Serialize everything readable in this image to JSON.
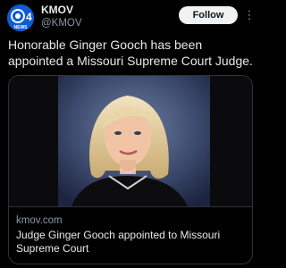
{
  "account": {
    "display_name": "KMOV",
    "handle": "@KMOV",
    "avatar": {
      "logo_text": "4",
      "logo_subtext": "NEWS",
      "brand_color": "#0f5bd3"
    }
  },
  "follow_label": "Follow",
  "more_icon": "more-dots-icon",
  "tweet_text": "Honorable Ginger Gooch has been appointed a Missouri Supreme Court Judge.",
  "card": {
    "image_description_icon": "portrait-photo",
    "domain": "kmov.com",
    "headline": "Judge Ginger Gooch appointed to Missouri Supreme Court"
  }
}
